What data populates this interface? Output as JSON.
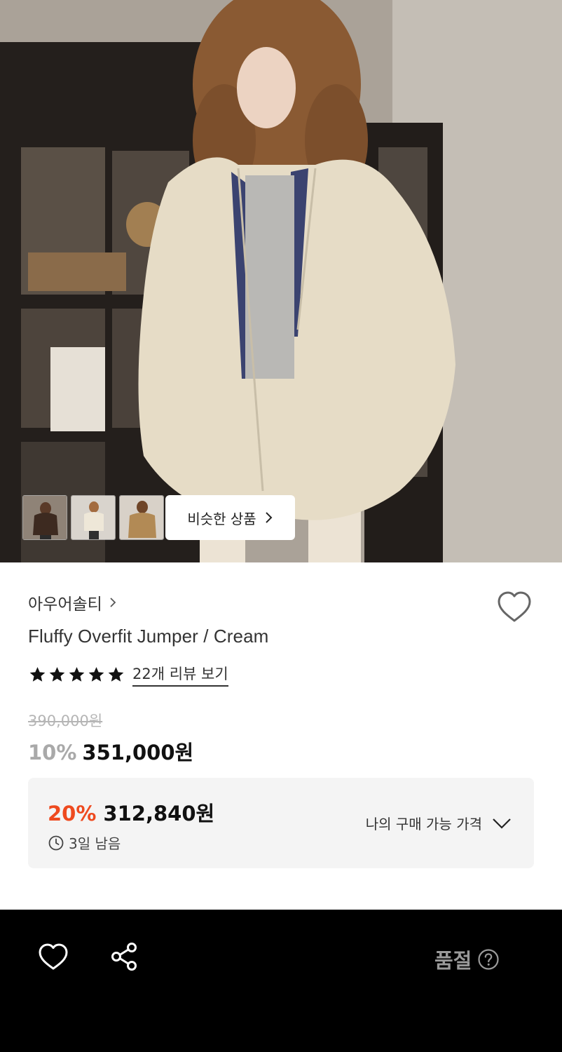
{
  "gallery": {
    "similar_label": "비슷한 상품",
    "thumbnails": [
      {
        "icon": "thumbnail-brown-jumper"
      },
      {
        "icon": "thumbnail-cream-jumper"
      },
      {
        "icon": "thumbnail-camel-jumper"
      }
    ]
  },
  "product": {
    "brand": "아우어솔티",
    "name": "Fluffy Overfit Jumper / Cream",
    "rating_stars": 5,
    "review_link": "22개 리뷰 보기",
    "original_price": "390,000원",
    "discount_rate": "10%",
    "sale_price": "351,000원"
  },
  "coupon": {
    "rate": "20%",
    "price": "312,840원",
    "time_left": "3일 남음",
    "my_price_label": "나의 구매 가능 가격"
  },
  "bottom_bar": {
    "status": "품절"
  },
  "colors": {
    "accent_orange": "#ee4a1f",
    "bar_bg": "#000000",
    "muted_gray": "#a9a9a9"
  }
}
